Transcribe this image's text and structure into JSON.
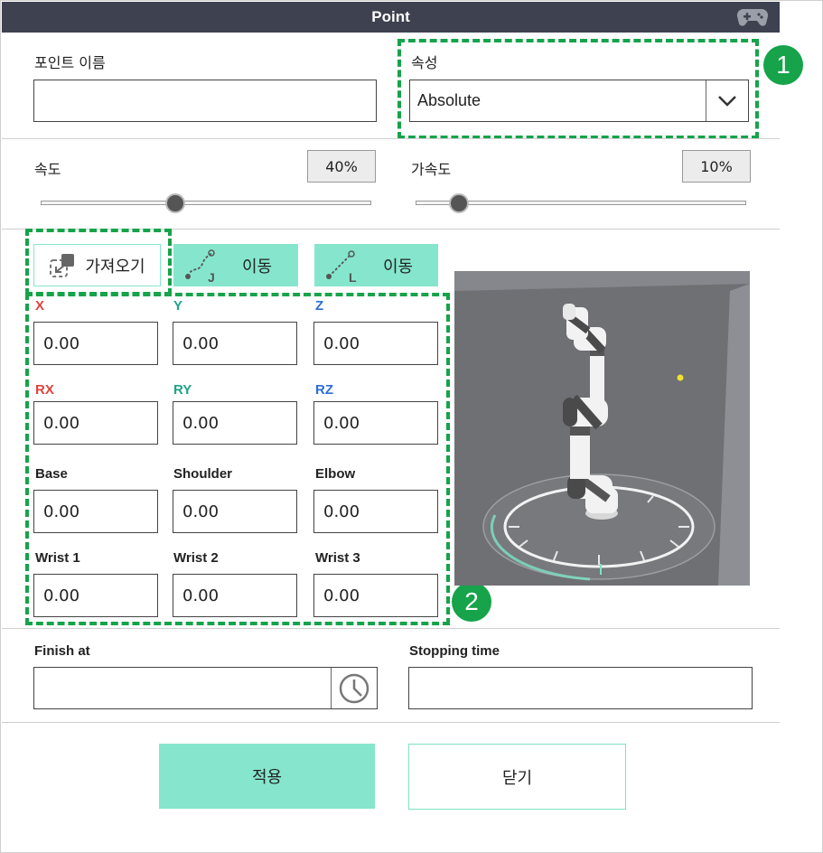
{
  "title": "Point",
  "point_name": {
    "label": "포인트 이름",
    "value": ""
  },
  "attribute": {
    "label": "속성",
    "selected": "Absolute"
  },
  "speed": {
    "label": "속도",
    "value": "40%",
    "level": 0.4
  },
  "accel": {
    "label": "가속도",
    "value": "10%",
    "level": 0.1
  },
  "actions": {
    "fetch_label": "가져오기",
    "move_j_label": "이동",
    "move_l_label": "이동",
    "j_glyph": "J",
    "l_glyph": "L"
  },
  "coords": [
    {
      "label": "X",
      "value": "0.00",
      "color": "#e0443e"
    },
    {
      "label": "Y",
      "value": "0.00",
      "color": "#1fa38a"
    },
    {
      "label": "Z",
      "value": "0.00",
      "color": "#2e6ed6"
    },
    {
      "label": "RX",
      "value": "0.00",
      "color": "#e0443e"
    },
    {
      "label": "RY",
      "value": "0.00",
      "color": "#1fa38a"
    },
    {
      "label": "RZ",
      "value": "0.00",
      "color": "#2e6ed6"
    }
  ],
  "joints": [
    {
      "label": "Base",
      "value": "0.00"
    },
    {
      "label": "Shoulder",
      "value": "0.00"
    },
    {
      "label": "Elbow",
      "value": "0.00"
    },
    {
      "label": "Wrist 1",
      "value": "0.00"
    },
    {
      "label": "Wrist 2",
      "value": "0.00"
    },
    {
      "label": "Wrist 3",
      "value": "0.00"
    }
  ],
  "finish_at": {
    "label": "Finish at",
    "value": ""
  },
  "stopping_time": {
    "label": "Stopping time",
    "value": ""
  },
  "footer": {
    "apply_label": "적용",
    "close_label": "닫기"
  },
  "callouts": {
    "one": "1",
    "two": "2"
  }
}
